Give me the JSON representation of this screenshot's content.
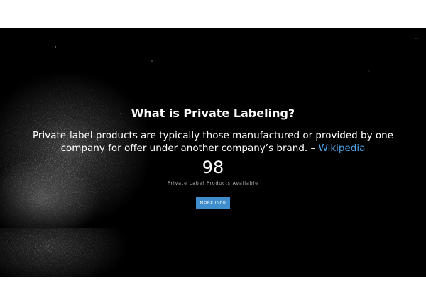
{
  "hero": {
    "title": "What is Private Labeling?",
    "description_text": "Private-label products are typically those manufactured or provided by one company for offer under another company’s brand. – ",
    "description_link": "Wikipedia",
    "counter_value": "98",
    "counter_label": "Private Label Products Available",
    "cta_label": "MORE INFO"
  },
  "icons": {
    "scroll_up_top": "chevron-up-icon",
    "scroll_up_bottom": "chevron-up-icon"
  },
  "colors": {
    "background": "#000000",
    "link": "#4da3e0",
    "button": "#3f8dcc"
  }
}
